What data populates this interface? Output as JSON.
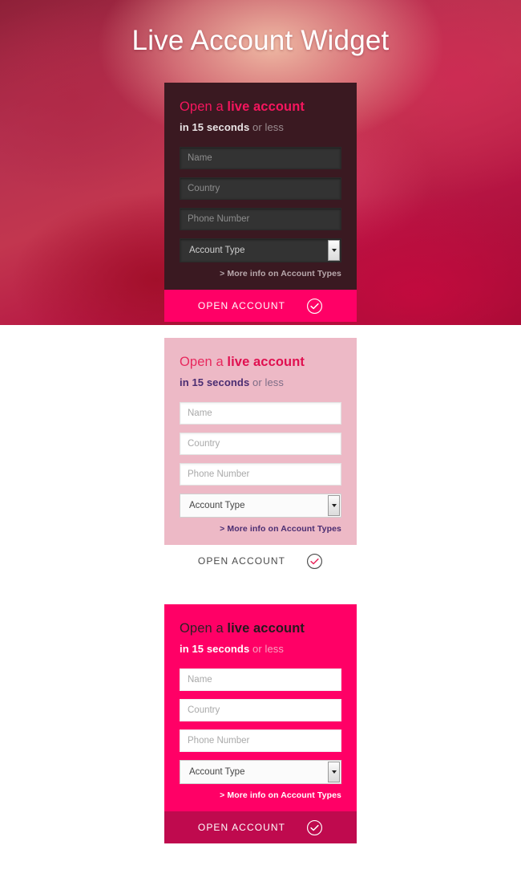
{
  "hero": {
    "title": "Live Account Widget",
    "background_colors": [
      "#8e2038",
      "#b4304f",
      "#c2364f",
      "#b51442",
      "#9e0b32"
    ]
  },
  "widget": {
    "heading_prefix": "Open a ",
    "heading_strong": "live account",
    "subheading_strong": "in 15 seconds",
    "subheading_rest": " or less",
    "fields": [
      {
        "name": "name",
        "placeholder": "Name",
        "value": ""
      },
      {
        "name": "country",
        "placeholder": "Country",
        "value": ""
      },
      {
        "name": "phone",
        "placeholder": "Phone Number",
        "value": ""
      }
    ],
    "select": {
      "label": "Account Type",
      "selected": "Account Type",
      "arrow_icon": "chevron-down-icon"
    },
    "more_info_link": "> More info on Account Types",
    "cta_label": "OPEN ACCOUNT",
    "cta_icon": "check-circle-icon"
  },
  "variants": [
    {
      "id": "dark",
      "name": "dark-variant",
      "background": "#3a1921",
      "accent": "#ff0066",
      "heading_color": "#f5165e",
      "cta_background": "#ff0066",
      "cta_text_color": "#ffffff"
    },
    {
      "id": "light",
      "name": "light-pink-variant",
      "background": "#edb9c6",
      "accent": "#e01050",
      "heading_color": "#e8295e",
      "cta_background": "#ffffff",
      "cta_text_color": "#4a4a4a"
    },
    {
      "id": "pink",
      "name": "hot-pink-variant",
      "background": "#ff0066",
      "accent": "#bf0a4e",
      "heading_color": "#2e2024",
      "cta_background": "#bf0a4e",
      "cta_text_color": "#ffffff"
    }
  ]
}
